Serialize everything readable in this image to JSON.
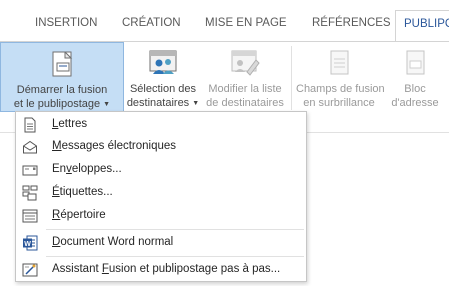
{
  "tabs": [
    {
      "label": "INSERTION"
    },
    {
      "label": "CRÉATION"
    },
    {
      "label": "MISE EN PAGE"
    },
    {
      "label": "RÉFÉRENCES"
    },
    {
      "label": "PUBLIPC"
    }
  ],
  "ribbon": {
    "start_merge": {
      "line1": "Démarrer la fusion",
      "line2": "et le publipostage"
    },
    "select_recipients": {
      "line1": "Sélection des",
      "line2": "destinataires"
    },
    "edit_list": {
      "line1": "Modifier la liste",
      "line2": "de destinataires"
    },
    "highlight_fields": {
      "line1": "Champs de fusion",
      "line2": "en surbrillance"
    },
    "address_block": {
      "line1": "Bloc",
      "line2": "d'adresse"
    }
  },
  "menu": {
    "items": [
      {
        "pre": "",
        "u": "L",
        "post": "ettres",
        "icon": "letter-icon"
      },
      {
        "pre": "",
        "u": "M",
        "post": "essages électroniques",
        "icon": "email-icon"
      },
      {
        "pre": "En",
        "u": "v",
        "post": "eloppes...",
        "icon": "envelope-icon"
      },
      {
        "pre": "",
        "u": "É",
        "post": "tiquettes...",
        "icon": "labels-icon"
      },
      {
        "pre": "",
        "u": "R",
        "post": "épertoire",
        "icon": "directory-icon"
      },
      {
        "pre": "",
        "u": "D",
        "post": "ocument Word normal",
        "icon": "word-document-icon"
      },
      {
        "pre": "Assistant ",
        "u": "F",
        "post": "usion et publipostage pas à pas...",
        "icon": "wizard-icon"
      }
    ]
  },
  "colors": {
    "accent": "#2b579a",
    "pressed_bg": "#c5def5",
    "pressed_border": "#8fb7e0"
  }
}
